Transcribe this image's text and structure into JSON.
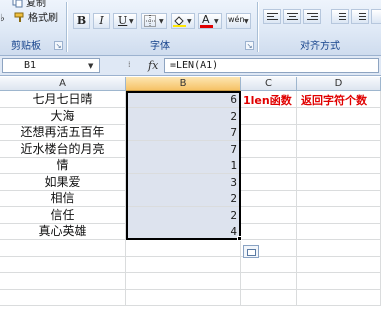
{
  "ribbon": {
    "clipboard": {
      "copy_label": "复制",
      "format_painter_label": "格式刷",
      "group_label": "剪贴板"
    },
    "font": {
      "bold": "B",
      "italic": "I",
      "underline": "U",
      "font_color_glyph": "A",
      "phonetic_glyph": "wén",
      "group_label": "字体"
    },
    "alignment": {
      "group_label": "对齐方式"
    }
  },
  "formula_bar": {
    "name_box": "B1",
    "fx_label": "fx",
    "formula": "=LEN(A1)"
  },
  "columns": [
    "A",
    "B",
    "C",
    "D"
  ],
  "rows": [
    {
      "a": "七月七日晴",
      "b": "6"
    },
    {
      "a": "大海",
      "b": "2"
    },
    {
      "a": "还想再活五百年",
      "b": "7"
    },
    {
      "a": "近水楼台的月亮",
      "b": "7"
    },
    {
      "a": "情",
      "b": "1"
    },
    {
      "a": "如果爱",
      "b": "3"
    },
    {
      "a": "相信",
      "b": "2"
    },
    {
      "a": "信任",
      "b": "2"
    },
    {
      "a": "真心英雄",
      "b": "4"
    }
  ],
  "annotations": {
    "c1": "1len函数",
    "d1": "返回字符个数"
  },
  "colors": {
    "annotation": "#e00000",
    "selection_fill": "#dde3ee",
    "active_header": "#f6c266"
  }
}
